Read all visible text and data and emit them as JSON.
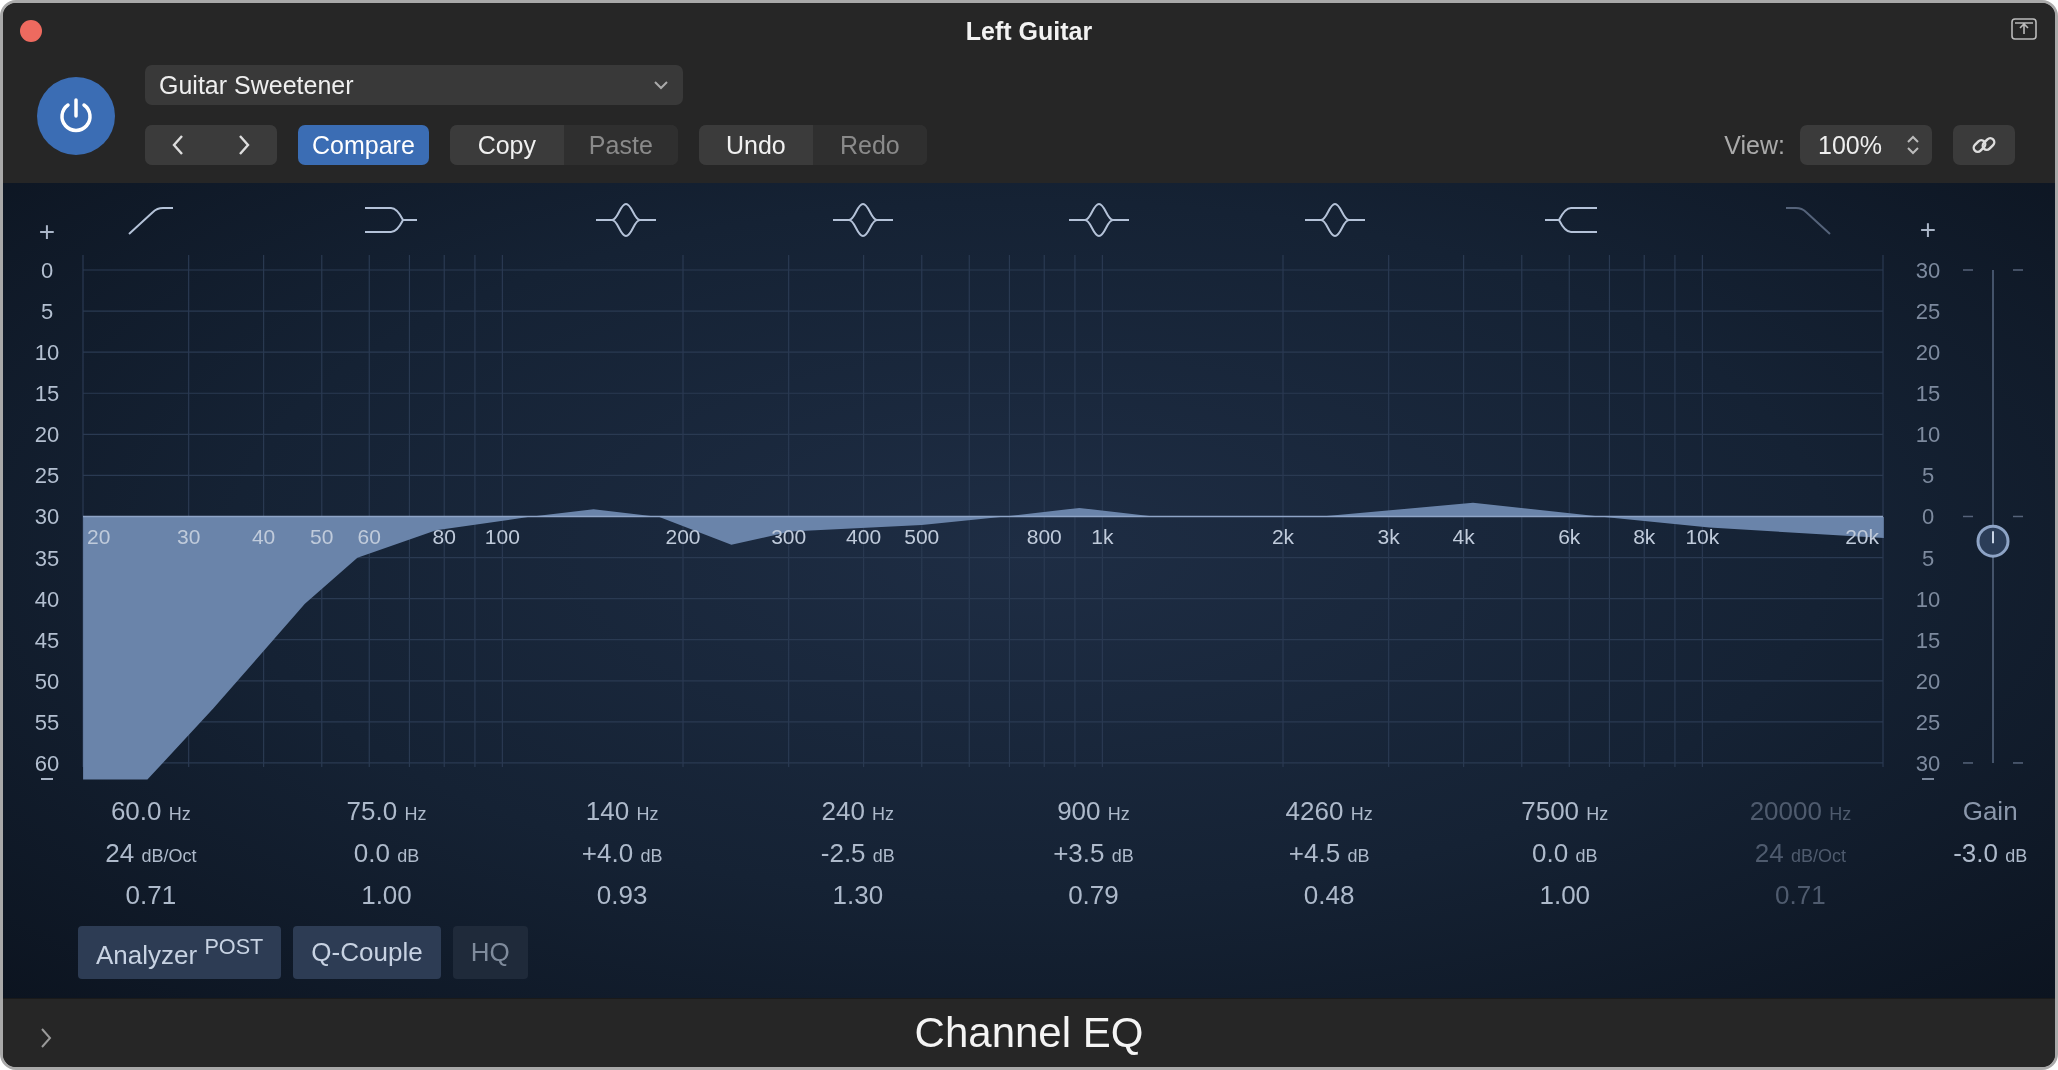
{
  "window": {
    "title": "Left Guitar"
  },
  "power": {
    "on": true
  },
  "preset": "Guitar Sweetener",
  "compare": {
    "label": "Compare",
    "selected": true
  },
  "edit_buttons": [
    {
      "label": "Copy",
      "disabled": false
    },
    {
      "label": "Paste",
      "disabled": true
    }
  ],
  "history_buttons": [
    {
      "label": "Undo",
      "disabled": false
    },
    {
      "label": "Redo",
      "disabled": true
    }
  ],
  "view": {
    "label": "View:",
    "value": "100%"
  },
  "graph": {
    "top_mark": "+",
    "left_scale": [
      "0",
      "5",
      "10",
      "15",
      "20",
      "25",
      "30",
      "35",
      "40",
      "45",
      "50",
      "55",
      "60"
    ],
    "right_scale": [
      "30",
      "25",
      "20",
      "15",
      "10",
      "5",
      "0",
      "5",
      "10",
      "15",
      "20",
      "25",
      "30"
    ],
    "frequency_labels": [
      "20",
      "30",
      "40",
      "50",
      "60",
      "80",
      "100",
      "200",
      "300",
      "400",
      "500",
      "800",
      "1k",
      "2k",
      "3k",
      "4k",
      "6k",
      "8k",
      "10k",
      "20k"
    ]
  },
  "bands": [
    {
      "kind": "lowcut",
      "on": true,
      "frequency": "60.0",
      "frequency_unit": "Hz",
      "value": "24",
      "value_unit": "dB/Oct",
      "q": "0.71"
    },
    {
      "kind": "lowshelf",
      "on": true,
      "frequency": "75.0",
      "frequency_unit": "Hz",
      "value": "0.0",
      "value_unit": "dB",
      "q": "1.00"
    },
    {
      "kind": "bell",
      "on": true,
      "frequency": "140",
      "frequency_unit": "Hz",
      "value": "+4.0",
      "value_unit": "dB",
      "q": "0.93"
    },
    {
      "kind": "bell",
      "on": true,
      "frequency": "240",
      "frequency_unit": "Hz",
      "value": "-2.5",
      "value_unit": "dB",
      "q": "1.30"
    },
    {
      "kind": "bell",
      "on": true,
      "frequency": "900",
      "frequency_unit": "Hz",
      "value": "+3.5",
      "value_unit": "dB",
      "q": "0.79"
    },
    {
      "kind": "bell",
      "on": true,
      "frequency": "4260",
      "frequency_unit": "Hz",
      "value": "+4.5",
      "value_unit": "dB",
      "q": "0.48"
    },
    {
      "kind": "highshelf",
      "on": true,
      "frequency": "7500",
      "frequency_unit": "Hz",
      "value": "0.0",
      "value_unit": "dB",
      "q": "1.00"
    },
    {
      "kind": "highcut",
      "on": false,
      "frequency": "20000",
      "frequency_unit": "Hz",
      "value": "24",
      "value_unit": "dB/Oct",
      "q": "0.71"
    }
  ],
  "gain": {
    "label": "Gain",
    "value": "-3.0",
    "unit": "dB",
    "level": 0.45
  },
  "toggles": [
    {
      "label": "Analyzer $^{POST}$",
      "on": true
    },
    {
      "label": "Q-Couple",
      "on": true
    },
    {
      "label": "HQ",
      "on": false
    }
  ],
  "footer": {
    "title": "Channel EQ"
  }
}
